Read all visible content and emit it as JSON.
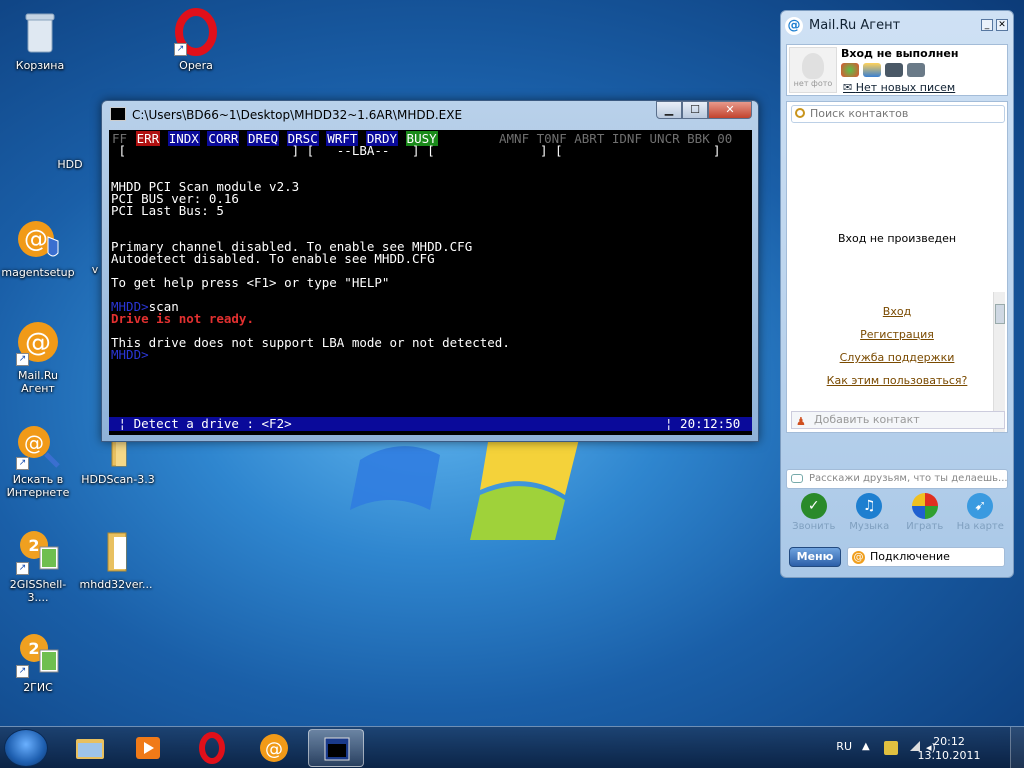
{
  "desktop": {
    "icons": {
      "recycle_bin": "Корзина",
      "opera": "Opera",
      "magentsetup": "magentsetup",
      "mailru_agent": "Mail.Ru Агент",
      "search_internet": "Искать в Интернете",
      "hddscan": "HDDScan-3.3",
      "gisshell": "2GISShell-3....",
      "mhdd32ver": "mhdd32ver...",
      "dgis": "2ГИС"
    },
    "partial_labels": {
      "hdd": "HDD",
      "v": "v"
    }
  },
  "dos_window": {
    "title": "C:\\Users\\BD66~1\\Desktop\\MHDD32~1.6AR\\MHDD.EXE",
    "buttons": {
      "min": "▁",
      "max": "☐",
      "close": "✕"
    },
    "flags": {
      "ff": "FF",
      "err": "ERR",
      "indx": "INDX",
      "corr": "CORR",
      "dreq": "DREQ",
      "drsc": "DRSC",
      "wrft": "WRFT",
      "drdy": "DRDY",
      "busy": "BUSY",
      "right": "AMNF T0NF ABRT IDNF UNCR BBK 00"
    },
    "brackets_line": " [                      ] [   --LBA--   ] [              ] [                    ]",
    "lines": {
      "l1": "MHDD PCI Scan module v2.3",
      "l2": "PCI BUS ver: 0.16",
      "l3": "PCI Last Bus: 5",
      "l4": "Primary channel disabled. To enable see MHDD.CFG",
      "l5": "Autodetect disabled. To enable see MHDD.CFG",
      "l6": "To get help press <F1> or type \"HELP\"",
      "prompt": "MHDD>",
      "cmd": "scan",
      "error": "Drive is not ready.",
      "l7": "This drive does not support LBA mode or not detected.",
      "prompt2": "MHDD>"
    },
    "status_left": " ¦ Detect a drive : <F2>",
    "status_right": "¦ 20:12:50 "
  },
  "agent": {
    "title": "Mail.Ru Агент",
    "buttons": {
      "min": "_",
      "close": "✕"
    },
    "profile_status": "Вход не выполнен",
    "no_photo": "нет фото",
    "mail_note": "Нет новых писем",
    "search_placeholder": "Поиск контактов",
    "not_logged": "Вход не произведен",
    "links": {
      "login": "Вход",
      "register": "Регистрация",
      "support": "Служба поддержки",
      "howto": "Как этим пользоваться?"
    },
    "add_contact": "Добавить контакт",
    "status_input": "Расскажи друзьям, что ты делаешь...",
    "apps": [
      "Звонить",
      "Музыка",
      "Играть",
      "На карте"
    ],
    "menu": "Меню",
    "connection": "Подключение"
  },
  "taskbar": {
    "lang": "RU",
    "time": "20:12",
    "date": "13.10.2011"
  }
}
